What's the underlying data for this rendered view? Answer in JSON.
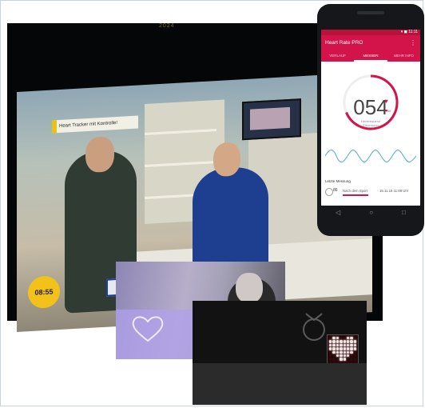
{
  "tv": {
    "brand_text": "2024",
    "banner_text": "Heart Tracker mit Kontrolle!",
    "clock_time": "08:55"
  },
  "phone": {
    "status_bar": "▾ ◼ 11:11",
    "app_title": "Heart Rate PRO",
    "menu_icon": "⋮",
    "tabs": [
      {
        "label": "VERLAUF",
        "active": false
      },
      {
        "label": "MESSEN",
        "active": true
      },
      {
        "label": "MEHR INFO",
        "active": false
      }
    ],
    "bpm_value": "054",
    "bpm_unit": "BPM",
    "heart_icon": "♥",
    "status_line1": "Herzfrequenz",
    "status_line2": "Erkennung",
    "last_measurement_title": "Letzte Messung",
    "last_value": "86",
    "last_label": "Nach dem Sport",
    "last_time": "15.11.18 11:08 Uhr",
    "nav": {
      "back": "◁",
      "home": "○",
      "recent": "□"
    },
    "accent_color": "#d3144a"
  },
  "pi": {
    "matrix_rows": [
      [
        0,
        1,
        1,
        0,
        0,
        1,
        1,
        0
      ],
      [
        1,
        1,
        1,
        1,
        1,
        1,
        1,
        1
      ],
      [
        1,
        1,
        1,
        1,
        1,
        1,
        1,
        1
      ],
      [
        1,
        1,
        1,
        1,
        1,
        1,
        1,
        1
      ],
      [
        0,
        1,
        1,
        1,
        1,
        1,
        1,
        0
      ],
      [
        0,
        0,
        1,
        1,
        1,
        1,
        0,
        0
      ],
      [
        0,
        0,
        0,
        1,
        1,
        0,
        0,
        0
      ],
      [
        0,
        0,
        0,
        0,
        0,
        0,
        0,
        0
      ]
    ]
  }
}
